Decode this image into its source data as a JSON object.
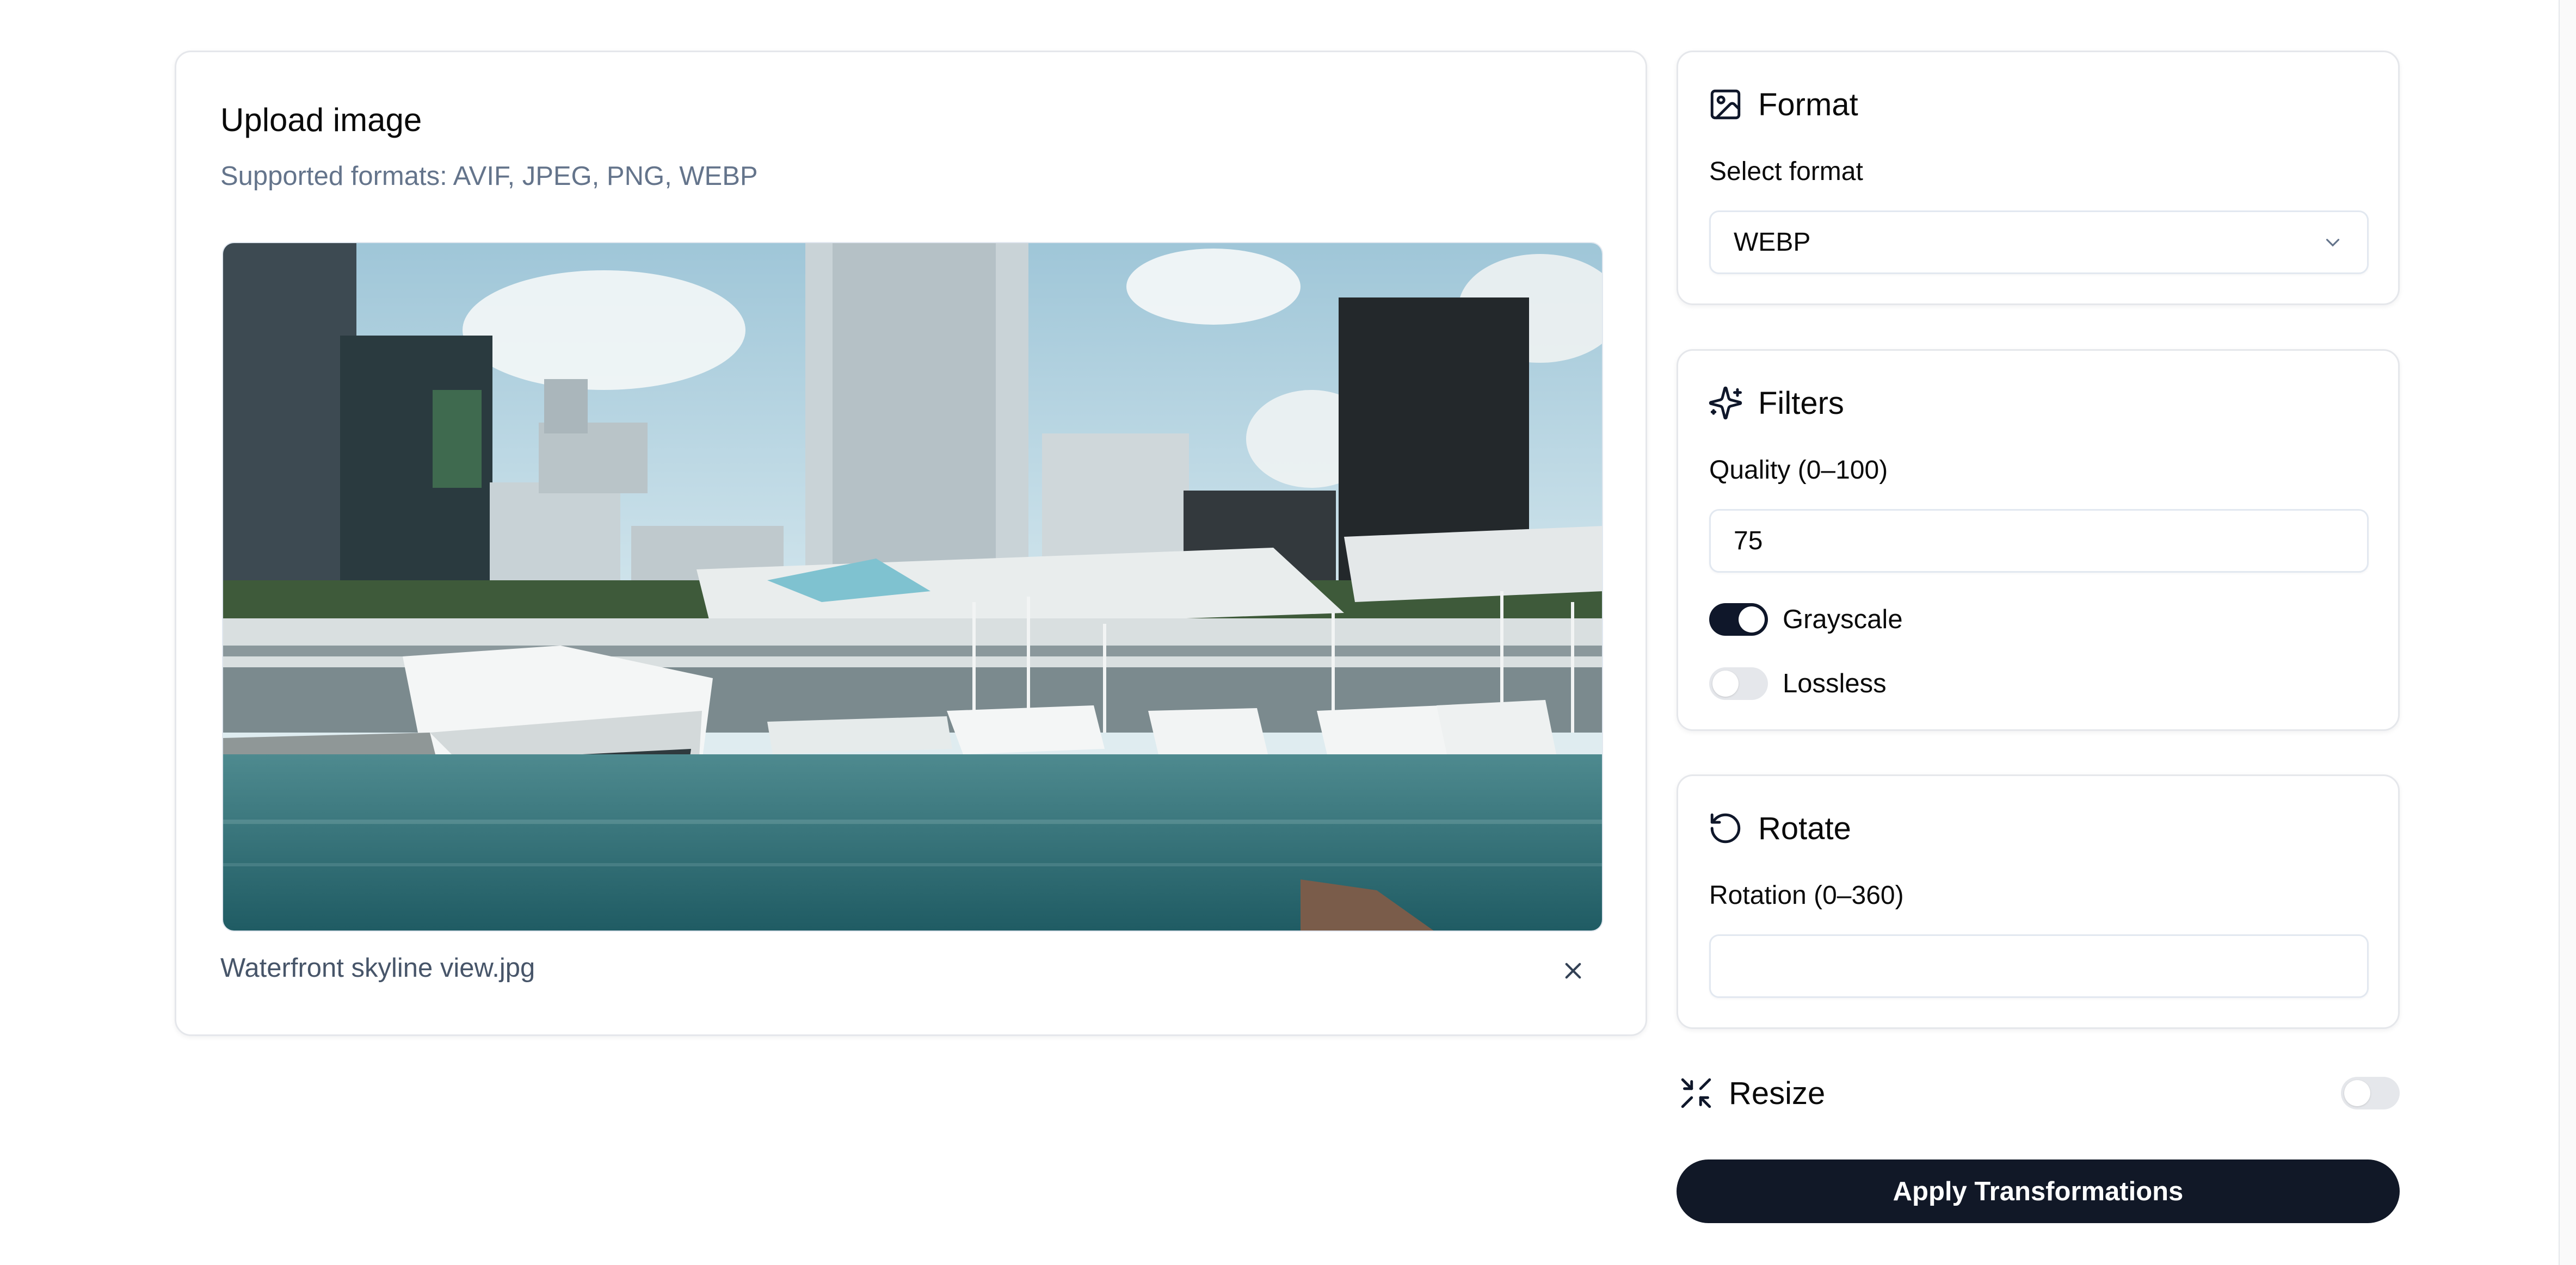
{
  "upload": {
    "title": "Upload image",
    "subtitle": "Supported formats: AVIF, JPEG, PNG, WEBP",
    "file_name": "Waterfront skyline view.jpg",
    "remove_icon": "close-icon",
    "preview_icon": "image-preview"
  },
  "format": {
    "title": "Format",
    "icon": "image-icon",
    "select_label": "Select format",
    "selected_value": "WEBP",
    "dropdown_icon": "chevron-down-icon"
  },
  "filters": {
    "title": "Filters",
    "icon": "sparkles-icon",
    "quality_label": "Quality (0–100)",
    "quality_value": "75",
    "grayscale_label": "Grayscale",
    "grayscale_on": true,
    "lossless_label": "Lossless",
    "lossless_on": false
  },
  "rotate": {
    "title": "Rotate",
    "icon": "rotate-ccw-icon",
    "rotation_label": "Rotation (0–360)",
    "rotation_value": ""
  },
  "resize": {
    "title": "Resize",
    "icon": "shrink-icon",
    "enabled": false
  },
  "actions": {
    "apply_label": "Apply Transformations"
  },
  "colors": {
    "primary": "#111827",
    "muted_text": "#64748b",
    "border": "#e5e7eb",
    "switch_off": "#e5e7eb"
  }
}
